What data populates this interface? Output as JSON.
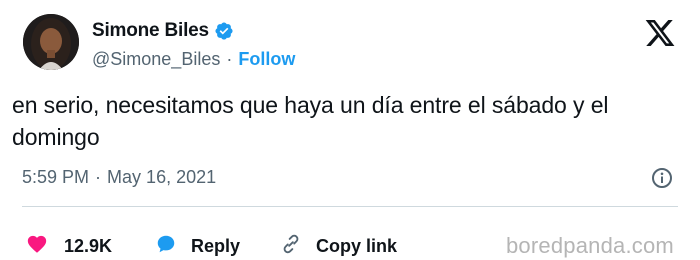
{
  "author": {
    "name": "Simone Biles",
    "handle": "@Simone_Biles",
    "separator": "·",
    "follow_label": "Follow"
  },
  "tweet": {
    "text": "en serio, necesitamos que haya un día entre el sábado y el domingo",
    "time": "5:59 PM",
    "date": "May 16, 2021",
    "meta_separator": "·"
  },
  "actions": {
    "like_count": "12.9K",
    "reply_label": "Reply",
    "copy_label": "Copy link"
  },
  "watermark": "boredpanda.com",
  "colors": {
    "accent": "#1d9bf0",
    "like": "#f91880",
    "text": "#0f1419",
    "muted": "#536471",
    "divider": "#cfd9de"
  },
  "icons": [
    "verified-badge-icon",
    "x-logo-icon",
    "info-icon",
    "heart-icon",
    "reply-bubble-icon",
    "link-icon"
  ]
}
